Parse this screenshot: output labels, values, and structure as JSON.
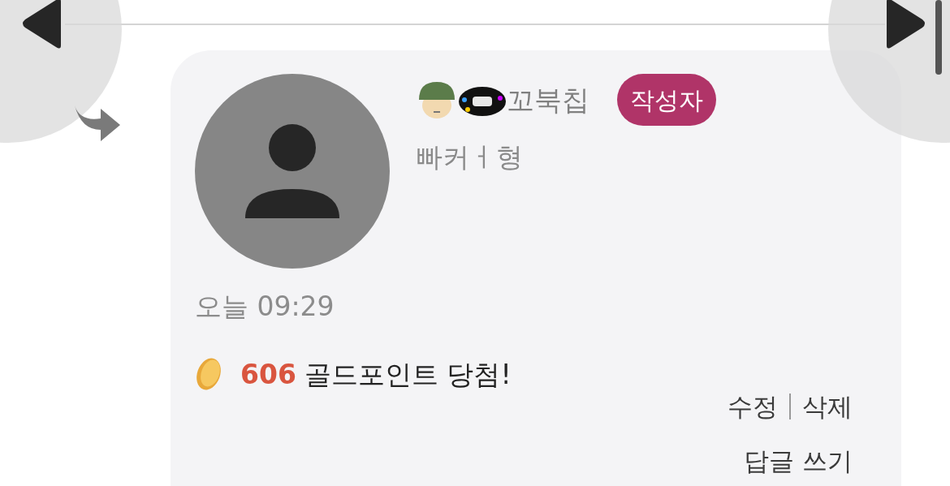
{
  "comment": {
    "reply_indicator": true,
    "author": {
      "name": "꼬북칩",
      "author_badge": "작성자",
      "subtitle": "빠커ㅓ형"
    },
    "time": "오늘 09:29",
    "points": "606",
    "message": "골드포인트 당첨!",
    "actions": [
      "수정",
      "삭제"
    ],
    "reply_action": "답글 쓰기"
  }
}
